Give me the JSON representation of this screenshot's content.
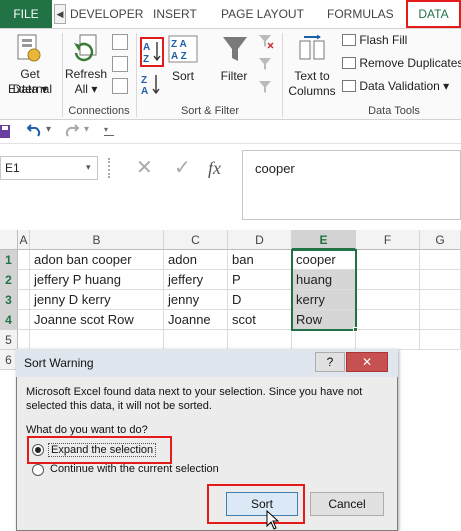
{
  "tabs": {
    "file": "FILE",
    "developer": "DEVELOPER",
    "insert": "INSERT",
    "page_layout": "PAGE LAYOUT",
    "formulas": "FORMULAS",
    "data": "DATA"
  },
  "ribbon": {
    "get_external_data_line1": "Get External",
    "get_external_data_line2": "Data",
    "refresh_all_line1": "Refresh",
    "refresh_all_line2": "All",
    "connections_group": "Connections",
    "sort": "Sort",
    "filter": "Filter",
    "sort_filter_group": "Sort & Filter",
    "text_to_columns_line1": "Text to",
    "text_to_columns_line2": "Columns",
    "flash_fill": "Flash Fill",
    "remove_duplicates": "Remove Duplicates",
    "data_validation": "Data Validation",
    "data_tools_group": "Data Tools"
  },
  "formula_bar": {
    "name_box": "E1",
    "fx": "fx",
    "content": "cooper"
  },
  "sheet": {
    "columns": [
      "A",
      "B",
      "C",
      "D",
      "E",
      "F",
      "G"
    ],
    "rows": [
      "1",
      "2",
      "3",
      "4",
      "5",
      "6"
    ],
    "data": [
      [
        "adon ban cooper",
        "adon",
        "ban",
        "cooper"
      ],
      [
        "jeffery P huang",
        "jeffery",
        "P",
        "huang"
      ],
      [
        "jenny D kerry",
        "jenny",
        "D",
        "kerry"
      ],
      [
        "Joanne scot Row",
        "Joanne",
        "scot",
        "Row"
      ]
    ]
  },
  "dialog": {
    "title": "Sort Warning",
    "help": "?",
    "close": "✕",
    "message_line1": "Microsoft Excel found data next to your selection.  Since you have not",
    "message_line2": "selected this data, it will not be sorted.",
    "question": "What do you want to do?",
    "option_expand": "Expand the selection",
    "option_continue": "Continue with the current selection",
    "sort_button": "Sort",
    "cancel_button": "Cancel"
  }
}
